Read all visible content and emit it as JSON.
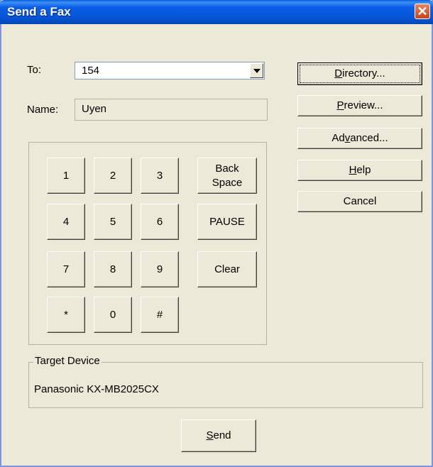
{
  "window": {
    "title": "Send a Fax",
    "close_glyph": "✕"
  },
  "to": {
    "label": "To:",
    "value": "154"
  },
  "name": {
    "label": "Name:",
    "value": "Uyen"
  },
  "keypad": {
    "keys": [
      "1",
      "2",
      "3",
      "4",
      "5",
      "6",
      "7",
      "8",
      "9",
      "*",
      "0",
      "#"
    ],
    "backspace_line1": "Back",
    "backspace_line2": "Space",
    "pause": "PAUSE",
    "clear": "Clear"
  },
  "side_buttons": {
    "directory": {
      "pre": "",
      "key": "D",
      "post": "irectory..."
    },
    "preview": {
      "pre": "",
      "key": "P",
      "post": "review..."
    },
    "advanced": {
      "pre": "Ad",
      "key": "v",
      "post": "anced..."
    },
    "help": {
      "pre": "",
      "key": "H",
      "post": "elp"
    },
    "cancel": {
      "label": "Cancel"
    }
  },
  "target_device": {
    "title": "Target Device",
    "value": "Panasonic KX-MB2025CX"
  },
  "send": {
    "pre": "",
    "key": "S",
    "post": "end"
  }
}
